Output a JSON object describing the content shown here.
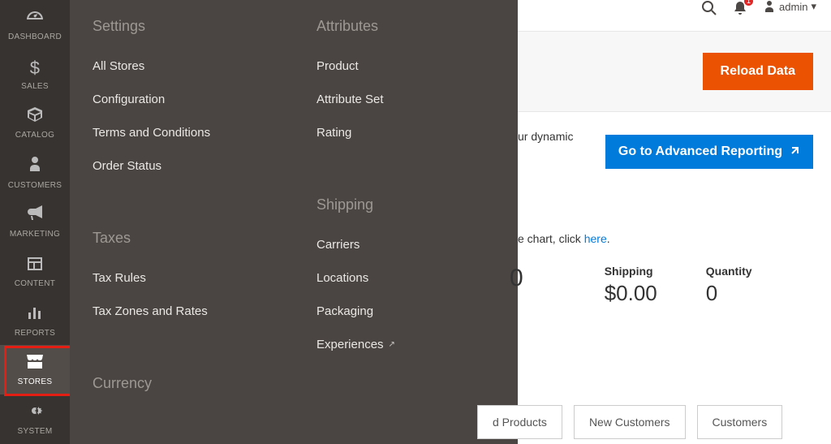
{
  "leftnav": {
    "dashboard": "DASHBOARD",
    "sales": "SALES",
    "catalog": "CATALOG",
    "customers": "CUSTOMERS",
    "marketing": "MARKETING",
    "content": "CONTENT",
    "reports": "REPORTS",
    "stores": "STORES",
    "system": "SYSTEM"
  },
  "flyout": {
    "settings_heading": "Settings",
    "all_stores": "All Stores",
    "configuration": "Configuration",
    "terms": "Terms and Conditions",
    "order_status": "Order Status",
    "taxes_heading": "Taxes",
    "tax_rules": "Tax Rules",
    "tax_zones": "Tax Zones and Rates",
    "currency_heading": "Currency",
    "attributes_heading": "Attributes",
    "product": "Product",
    "attribute_set": "Attribute Set",
    "rating": "Rating",
    "shipping_heading": "Shipping",
    "carriers": "Carriers",
    "locations": "Locations",
    "packaging": "Packaging",
    "experiences": "Experiences"
  },
  "topbar": {
    "admin_label": "admin"
  },
  "header": {
    "reload_button": "Reload Data"
  },
  "advanced": {
    "text_fragment": "ur dynamic",
    "button": "Go to Advanced Reporting"
  },
  "chart": {
    "text_fragment": "e chart, click ",
    "here": "here",
    "period": "."
  },
  "stats": {
    "zero_big": "0",
    "shipping_label": "Shipping",
    "shipping_value": "$0.00",
    "quantity_label": "Quantity",
    "quantity_value": "0"
  },
  "tabs": {
    "products": "d Products",
    "new_customers": "New Customers",
    "customers": "Customers"
  }
}
